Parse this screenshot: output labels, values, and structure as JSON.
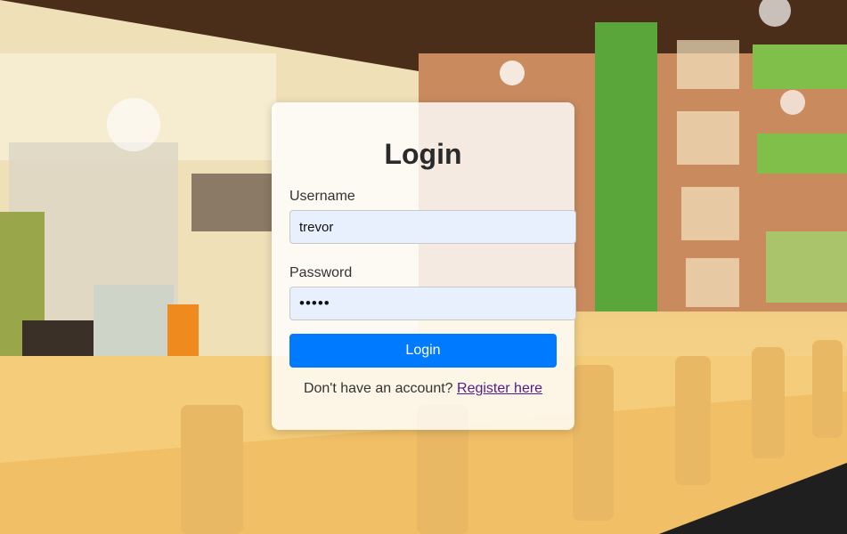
{
  "login": {
    "title": "Login",
    "username_label": "Username",
    "username_value": "trevor",
    "password_label": "Password",
    "password_value": "•••••",
    "submit_label": "Login",
    "register_prompt": "Don't have an account?",
    "register_link": "Register here"
  },
  "colors": {
    "button": "#007bff",
    "input_bg": "#e8f0fe",
    "link": "#551a8b"
  }
}
